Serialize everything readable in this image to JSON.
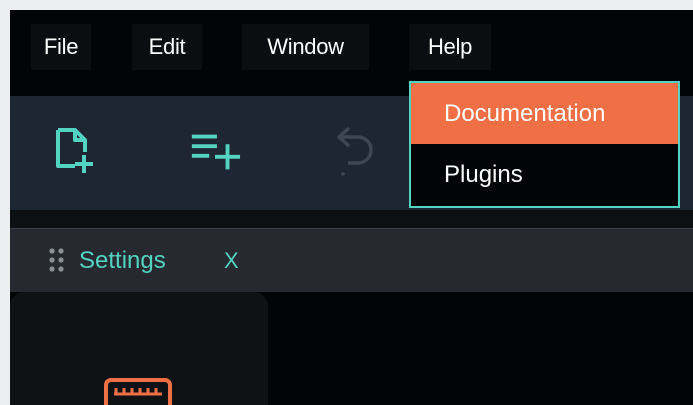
{
  "menubar": {
    "items": [
      {
        "label": "File"
      },
      {
        "label": "Edit"
      },
      {
        "label": "Window"
      },
      {
        "label": "Help"
      }
    ]
  },
  "toolbar": {
    "icons": [
      "new-file-icon",
      "add-to-list-icon",
      "undo-icon"
    ]
  },
  "help_menu": {
    "items": [
      {
        "label": "Documentation",
        "highlighted": true
      },
      {
        "label": "Plugins",
        "highlighted": false
      }
    ]
  },
  "tab": {
    "label": "Settings",
    "close_label": "X",
    "grip_icon": "drag-handle-icon"
  },
  "sidebar": {
    "icon": "keyboard-icon"
  },
  "colors": {
    "accent": "#53d3c1",
    "highlight": "#f06f44",
    "toolbar_bg": "#1f2633",
    "menubar_bg": "#030405"
  }
}
